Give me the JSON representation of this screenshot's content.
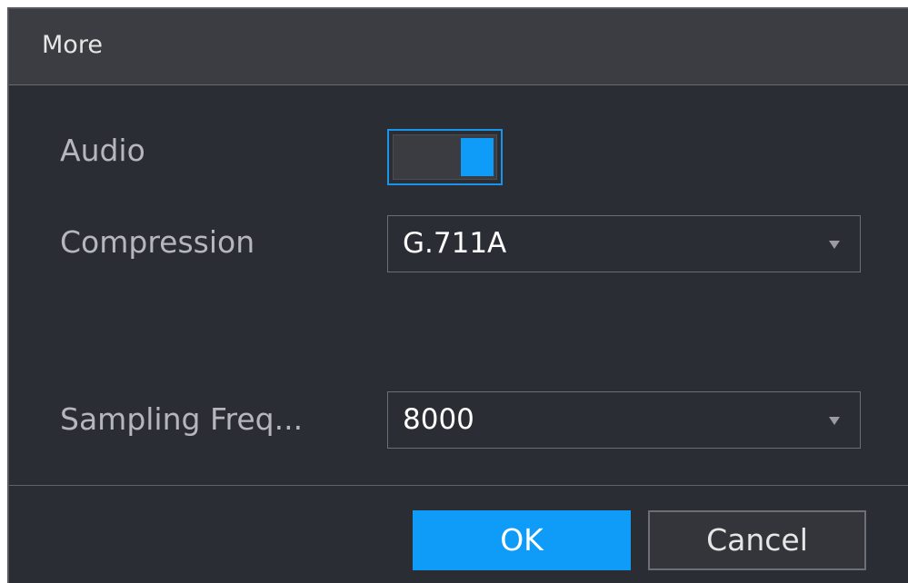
{
  "dialog": {
    "title": "More"
  },
  "audio": {
    "label": "Audio",
    "enabled": true
  },
  "compression": {
    "label": "Compression",
    "value": "G.711A"
  },
  "sampling": {
    "label": "Sampling Freq...",
    "value": "8000"
  },
  "buttons": {
    "ok": "OK",
    "cancel": "Cancel"
  },
  "colors": {
    "accent": "#0e9cf8",
    "background": "#2b2d34",
    "titlebar": "#3b3d43"
  }
}
